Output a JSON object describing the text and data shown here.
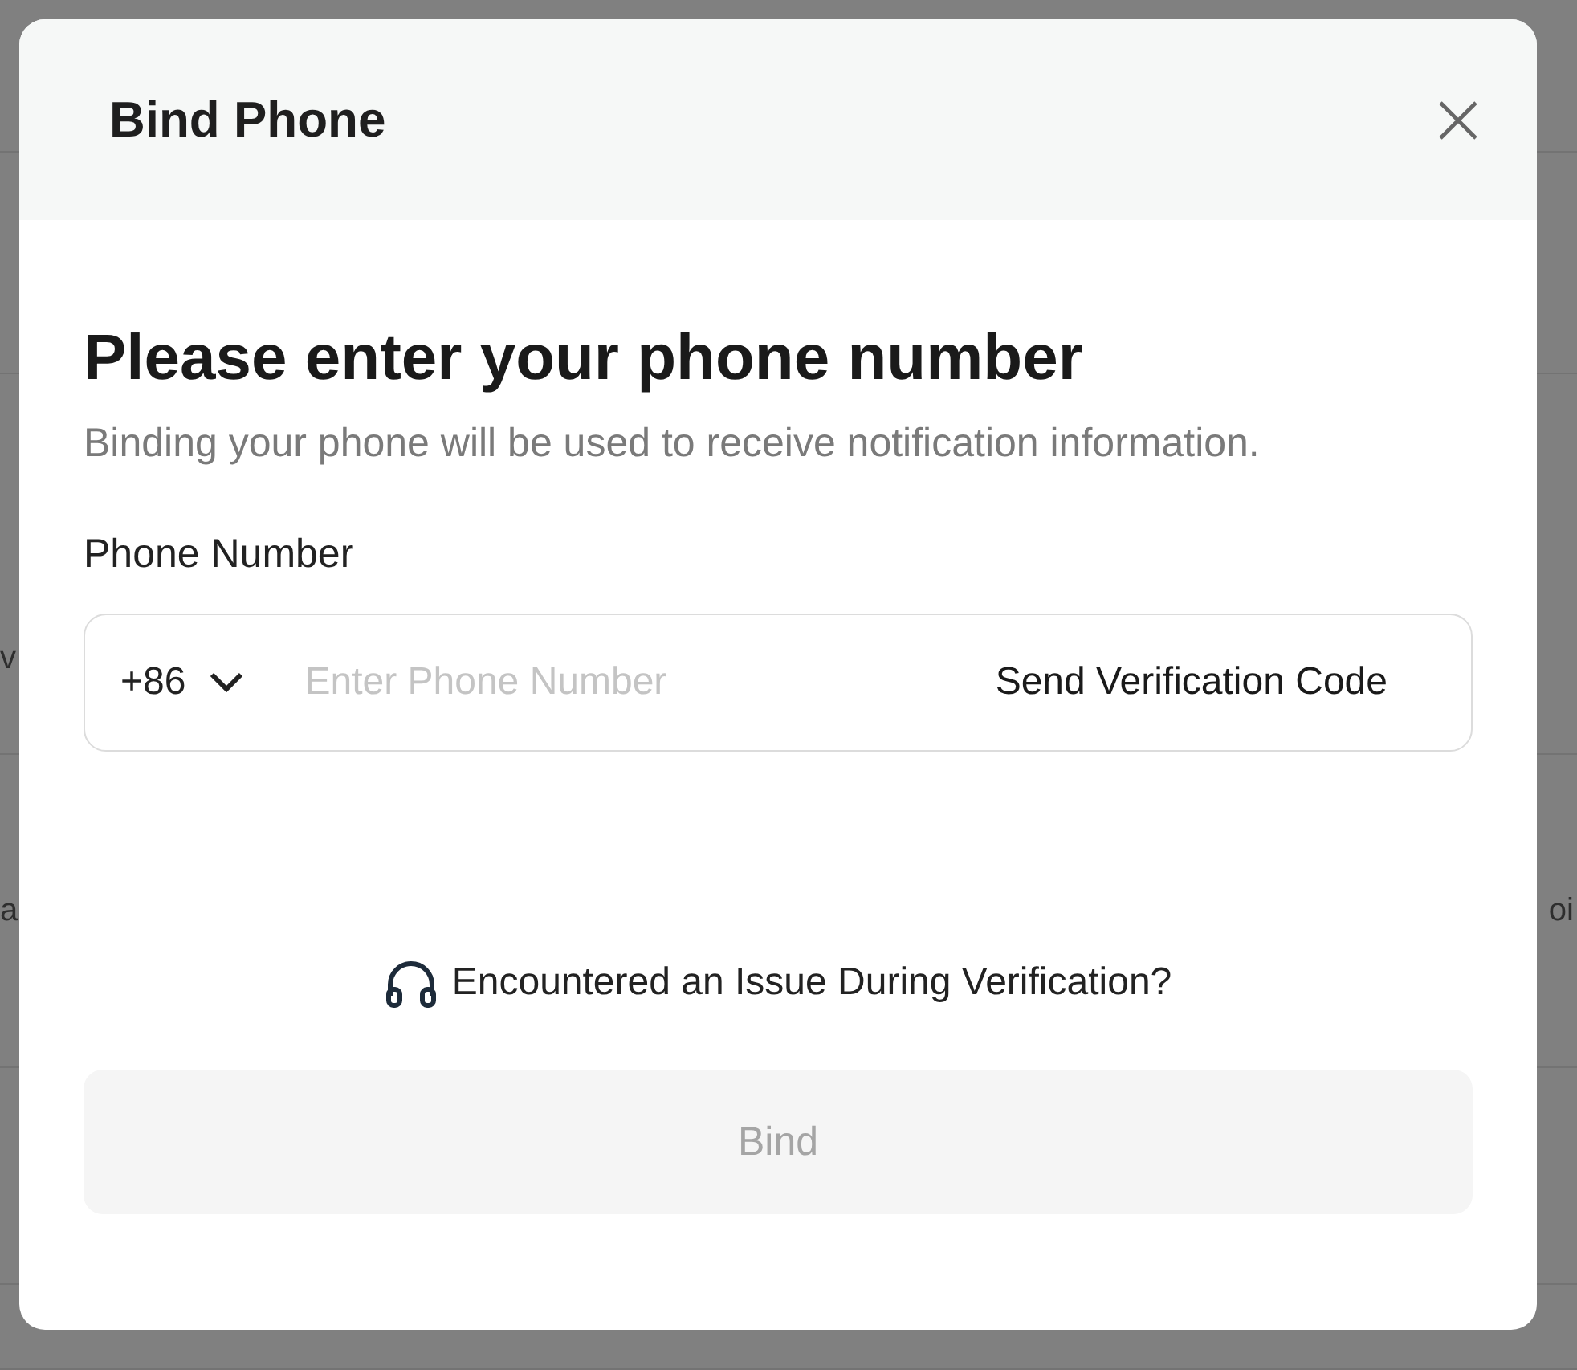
{
  "background": {
    "fragments_left": [
      "v",
      "a"
    ],
    "fragments_right": [
      "oi"
    ]
  },
  "dialog": {
    "title": "Bind Phone",
    "heading": "Please enter your phone number",
    "subtitle": "Binding your phone will be used to receive notification information.",
    "phone_label": "Phone Number",
    "country_code": "+86",
    "phone_placeholder": "Enter Phone Number",
    "send_code": "Send Verification Code",
    "help": "Encountered an Issue During Verification?",
    "bind_button": {
      "label": "Bind",
      "disabled": true
    }
  }
}
